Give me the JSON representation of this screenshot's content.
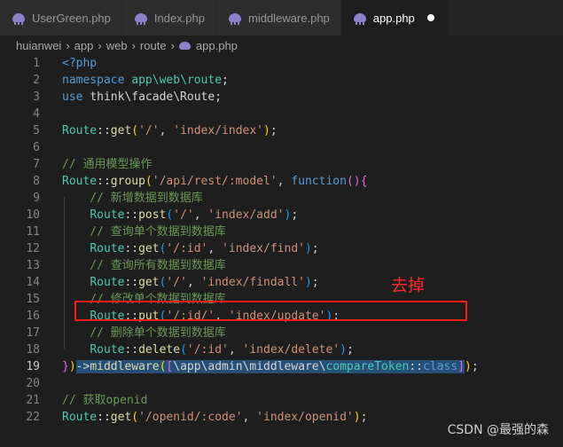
{
  "tabs": [
    {
      "label": "UserGreen.php"
    },
    {
      "label": "Index.php"
    },
    {
      "label": "middleware.php"
    },
    {
      "label": "app.php"
    }
  ],
  "breadcrumb": [
    "huianwei",
    "app",
    "web",
    "route",
    "app.php"
  ],
  "lines": [
    {
      "n": "1",
      "tokens": [
        {
          "t": "<?php",
          "c": "k"
        }
      ]
    },
    {
      "n": "2",
      "tokens": [
        {
          "t": "namespace ",
          "c": "k"
        },
        {
          "t": "app\\web\\route",
          "c": "t"
        },
        {
          "t": ";",
          "c": "p"
        }
      ]
    },
    {
      "n": "3",
      "tokens": [
        {
          "t": "use ",
          "c": "k"
        },
        {
          "t": "think\\facade\\Route",
          "c": "p"
        },
        {
          "t": ";",
          "c": "p"
        }
      ]
    },
    {
      "n": "4",
      "tokens": []
    },
    {
      "n": "5",
      "tokens": [
        {
          "t": "Route",
          "c": "t"
        },
        {
          "t": "::",
          "c": "p"
        },
        {
          "t": "get",
          "c": "f"
        },
        {
          "t": "(",
          "c": "b1"
        },
        {
          "t": "'/'",
          "c": "s"
        },
        {
          "t": ", ",
          "c": "p"
        },
        {
          "t": "'index/index'",
          "c": "s"
        },
        {
          "t": ")",
          "c": "b1"
        },
        {
          "t": ";",
          "c": "p"
        }
      ]
    },
    {
      "n": "6",
      "tokens": []
    },
    {
      "n": "7",
      "tokens": [
        {
          "t": "// 通用模型操作",
          "c": "c"
        }
      ]
    },
    {
      "n": "8",
      "tokens": [
        {
          "t": "Route",
          "c": "t"
        },
        {
          "t": "::",
          "c": "p"
        },
        {
          "t": "group",
          "c": "f"
        },
        {
          "t": "(",
          "c": "b1"
        },
        {
          "t": "'/api/rest/:model'",
          "c": "s"
        },
        {
          "t": ", ",
          "c": "p"
        },
        {
          "t": "function",
          "c": "k"
        },
        {
          "t": "()",
          "c": "b2"
        },
        {
          "t": "{",
          "c": "b2"
        }
      ]
    },
    {
      "n": "9",
      "tokens": [
        {
          "t": "    // 新增数据到数据库",
          "c": "c"
        }
      ]
    },
    {
      "n": "10",
      "tokens": [
        {
          "t": "    ",
          "c": "p"
        },
        {
          "t": "Route",
          "c": "t"
        },
        {
          "t": "::",
          "c": "p"
        },
        {
          "t": "post",
          "c": "f"
        },
        {
          "t": "(",
          "c": "b3"
        },
        {
          "t": "'/'",
          "c": "s"
        },
        {
          "t": ", ",
          "c": "p"
        },
        {
          "t": "'index/add'",
          "c": "s"
        },
        {
          "t": ")",
          "c": "b3"
        },
        {
          "t": ";",
          "c": "p"
        }
      ]
    },
    {
      "n": "11",
      "tokens": [
        {
          "t": "    // 查询单个数据到数据库",
          "c": "c"
        }
      ]
    },
    {
      "n": "12",
      "tokens": [
        {
          "t": "    ",
          "c": "p"
        },
        {
          "t": "Route",
          "c": "t"
        },
        {
          "t": "::",
          "c": "p"
        },
        {
          "t": "get",
          "c": "f"
        },
        {
          "t": "(",
          "c": "b3"
        },
        {
          "t": "'/:id'",
          "c": "s"
        },
        {
          "t": ", ",
          "c": "p"
        },
        {
          "t": "'index/find'",
          "c": "s"
        },
        {
          "t": ")",
          "c": "b3"
        },
        {
          "t": ";",
          "c": "p"
        }
      ]
    },
    {
      "n": "13",
      "tokens": [
        {
          "t": "    // 查询所有数据到数据库",
          "c": "c"
        }
      ]
    },
    {
      "n": "14",
      "tokens": [
        {
          "t": "    ",
          "c": "p"
        },
        {
          "t": "Route",
          "c": "t"
        },
        {
          "t": "::",
          "c": "p"
        },
        {
          "t": "get",
          "c": "f"
        },
        {
          "t": "(",
          "c": "b3"
        },
        {
          "t": "'/'",
          "c": "s"
        },
        {
          "t": ", ",
          "c": "p"
        },
        {
          "t": "'index/findall'",
          "c": "s"
        },
        {
          "t": ")",
          "c": "b3"
        },
        {
          "t": ";",
          "c": "p"
        }
      ]
    },
    {
      "n": "15",
      "tokens": [
        {
          "t": "    // 修改单个数据到数据库",
          "c": "c"
        }
      ]
    },
    {
      "n": "16",
      "tokens": [
        {
          "t": "    ",
          "c": "p"
        },
        {
          "t": "Route",
          "c": "t"
        },
        {
          "t": "::",
          "c": "p"
        },
        {
          "t": "put",
          "c": "f"
        },
        {
          "t": "(",
          "c": "b3"
        },
        {
          "t": "'/:id/'",
          "c": "s"
        },
        {
          "t": ", ",
          "c": "p"
        },
        {
          "t": "'index/update'",
          "c": "s"
        },
        {
          "t": ")",
          "c": "b3"
        },
        {
          "t": ";",
          "c": "p"
        }
      ]
    },
    {
      "n": "17",
      "tokens": [
        {
          "t": "    // 删除单个数据到数据库",
          "c": "c"
        }
      ]
    },
    {
      "n": "18",
      "tokens": [
        {
          "t": "    ",
          "c": "p"
        },
        {
          "t": "Route",
          "c": "t"
        },
        {
          "t": "::",
          "c": "p"
        },
        {
          "t": "delete",
          "c": "f"
        },
        {
          "t": "(",
          "c": "b3"
        },
        {
          "t": "'/:id'",
          "c": "s"
        },
        {
          "t": ", ",
          "c": "p"
        },
        {
          "t": "'index/delete'",
          "c": "s"
        },
        {
          "t": ")",
          "c": "b3"
        },
        {
          "t": ";",
          "c": "p"
        }
      ]
    },
    {
      "n": "19",
      "tokens": [
        {
          "t": "}",
          "c": "b2"
        },
        {
          "t": ")",
          "c": "b1"
        },
        {
          "t": "->",
          "c": "p sel"
        },
        {
          "t": "middleware",
          "c": "f sel"
        },
        {
          "t": "(",
          "c": "b1 sel"
        },
        {
          "t": "[",
          "c": "b2 sel"
        },
        {
          "t": "\\app\\admin\\middleware\\",
          "c": "p sel"
        },
        {
          "t": "compareToken",
          "c": "t sel"
        },
        {
          "t": "::",
          "c": "p sel"
        },
        {
          "t": "class",
          "c": "k sel"
        },
        {
          "t": "]",
          "c": "b2 sel"
        },
        {
          "t": ")",
          "c": "b1"
        },
        {
          "t": ";",
          "c": "p"
        }
      ]
    },
    {
      "n": "20",
      "tokens": []
    },
    {
      "n": "21",
      "tokens": [
        {
          "t": "// 获取openid",
          "c": "c"
        }
      ]
    },
    {
      "n": "22",
      "tokens": [
        {
          "t": "Route",
          "c": "t"
        },
        {
          "t": "::",
          "c": "p"
        },
        {
          "t": "get",
          "c": "f"
        },
        {
          "t": "(",
          "c": "b1"
        },
        {
          "t": "'/openid/:code'",
          "c": "s"
        },
        {
          "t": ", ",
          "c": "p"
        },
        {
          "t": "'index/openid'",
          "c": "s"
        },
        {
          "t": ")",
          "c": "b1"
        },
        {
          "t": ";",
          "c": "p"
        }
      ]
    }
  ],
  "annotation": "去掉",
  "watermark": "CSDN @最强的森"
}
